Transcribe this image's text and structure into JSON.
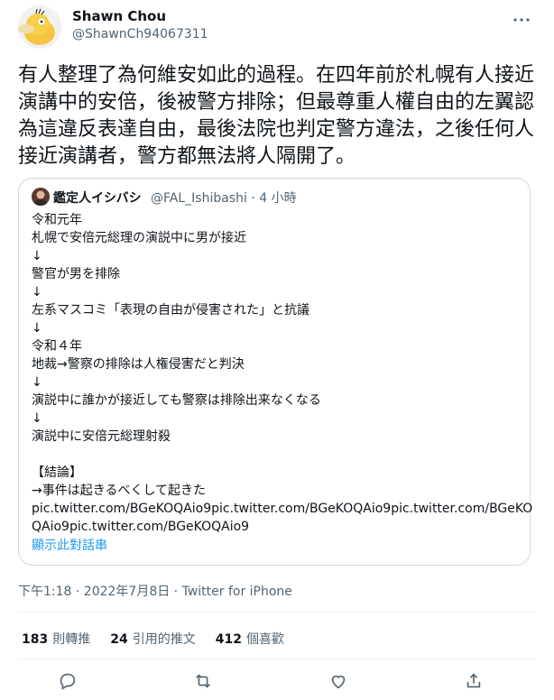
{
  "author": {
    "name": "Shawn Chou",
    "handle": "@ShawnCh94067311"
  },
  "tweet": {
    "text": "有人整理了為何維安如此的過程。在四年前於札幌有人接近演講中的安倍，後被警方排除；但最尊重人權自由的左翼認為這違反表達自由，最後法院也判定警方違法，之後任何人接近演講者，警方都無法將人隔開了。"
  },
  "quote": {
    "name": "鑑定人イシバシ",
    "handle": "@FAL_Ishibashi",
    "time": "· 4 小時",
    "lines": [
      "令和元年",
      "札幌で安倍元総理の演説中に男が接近",
      "↓",
      "警官が男を排除",
      "↓",
      "左系マスコミ「表現の自由が侵害された」と抗議",
      "↓",
      "令和４年",
      "地裁→警察の排除は人権侵害だと判決",
      "↓",
      "演説中に誰かが接近しても警察は排除出来なくなる",
      "↓",
      "演説中に安倍元総理射殺",
      "",
      "【結論】",
      "→事件は起きるべくして起きた",
      "pic.twitter.com/BGeKOQAio9pic.twitter.com/BGeKOQAio9pic.twitter.com/BGeKO",
      "QAio9pic.twitter.com/BGeKOQAio9"
    ],
    "show_thread": "顯示此對話串"
  },
  "meta": {
    "text": "下午1:18 · 2022年7月8日 · Twitter for iPhone"
  },
  "stats": {
    "retweets_count": "183",
    "retweets_label": "則轉推",
    "quotes_count": "24",
    "quotes_label": "引用的推文",
    "likes_count": "412",
    "likes_label": "個喜歡"
  },
  "icons": [
    "more-icon",
    "reply-icon",
    "retweet-icon",
    "like-icon",
    "share-icon"
  ],
  "colors": {
    "link": "#1d9bf0",
    "secondary_text": "#536471",
    "border": "#cfd9de"
  }
}
